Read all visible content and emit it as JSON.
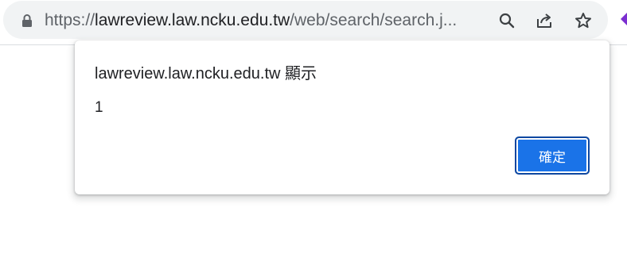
{
  "browser": {
    "url_scheme": "https://",
    "url_domain": "lawreview.law.ncku.edu.tw",
    "url_path": "/web/search/search.j...",
    "icons": {
      "lock": "lock-icon",
      "zoom": "magnifier-icon",
      "share": "share-icon",
      "bookmark": "star-icon",
      "extension": "extension-icon"
    },
    "extension_color": "#7b2fd0"
  },
  "dialog": {
    "title": "lawreview.law.ncku.edu.tw 顯示",
    "message": "1",
    "ok_label": "確定",
    "button_color": "#1a73e8"
  }
}
